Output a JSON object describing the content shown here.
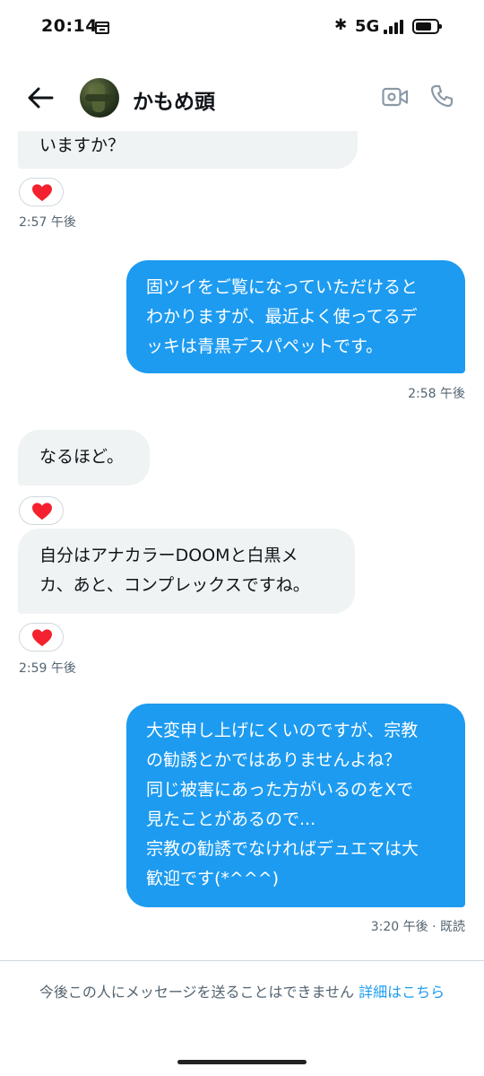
{
  "status_bar": {
    "time": "20:14",
    "network": "5G",
    "battery_level": 0.75
  },
  "header": {
    "contact_name": "かもめ頭"
  },
  "messages": [
    {
      "direction": "in",
      "lines": [
        "いますか？"
      ],
      "reaction": "heart",
      "timestamp": "2:57 午後"
    },
    {
      "direction": "out",
      "lines": [
        "固ツイをご覧になっていただけると",
        "わかりますが、最近よく使ってるデ",
        "ッキは青黒デスパペットです。"
      ],
      "timestamp": "2:58 午後"
    },
    {
      "direction": "in",
      "lines": [
        "なるほど。"
      ],
      "reaction": "heart"
    },
    {
      "direction": "in",
      "lines": [
        "自分はアナカラーDOOMと白黒メ",
        "カ、あと、コンプレックスですね。"
      ],
      "reaction": "heart",
      "timestamp": "2:59 午後"
    },
    {
      "direction": "out",
      "lines": [
        "大変申し上げにくいのですが、宗教",
        "の勧誘とかではありませんよね？",
        "同じ被害にあった方がいるのをXで",
        "見たことがあるので...",
        "宗教の勧誘でなければデュエマは大",
        "歓迎です(*^^^)"
      ],
      "timestamp": "3:20 午後 · 既読"
    }
  ],
  "footer": {
    "notice_text": "今後この人にメッセージを送ることはできません",
    "details_link": "詳細はこちら"
  },
  "colors": {
    "accent": "#1d9bf0",
    "incoming_bubble": "#eff3f4",
    "secondary_text": "#536471",
    "heart": "#f91880"
  }
}
